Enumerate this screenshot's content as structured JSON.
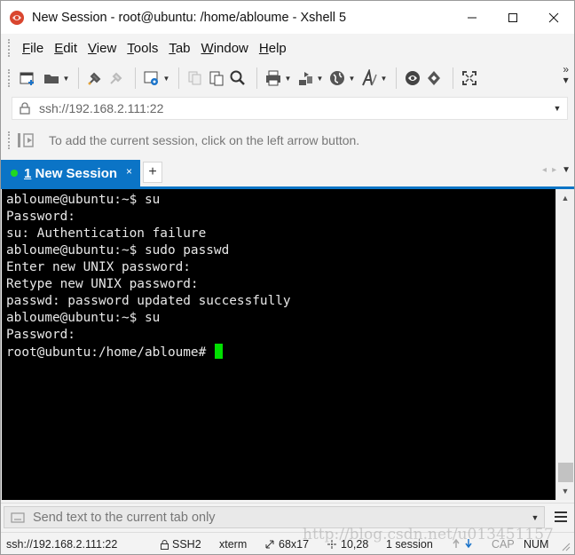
{
  "window": {
    "title": "New Session - root@ubuntu: /home/abloume - Xshell 5",
    "controls": {
      "minimize": "—",
      "maximize": "☐",
      "close": "✕"
    }
  },
  "menu": {
    "items": [
      {
        "accel": "F",
        "rest": "ile"
      },
      {
        "accel": "E",
        "rest": "dit"
      },
      {
        "accel": "V",
        "rest": "iew"
      },
      {
        "accel": "T",
        "rest": "ools"
      },
      {
        "accel": "T",
        "rest": "ab"
      },
      {
        "accel": "W",
        "rest": "indow"
      },
      {
        "accel": "H",
        "rest": "elp"
      }
    ]
  },
  "toolbar": {
    "icons": [
      "new-session-icon",
      "open-folder-icon",
      "connect-icon",
      "disconnect-icon",
      "properties-icon",
      "copy-icon",
      "paste-icon",
      "find-icon",
      "print-icon",
      "transfer-icon",
      "globe-icon",
      "font-icon",
      "xftp-icon",
      "xmanager-icon",
      "fullscreen-icon"
    ],
    "more": "»"
  },
  "address": {
    "value": "ssh://192.168.2.111:22"
  },
  "hint": {
    "text": "To add the current session, click on the left arrow button."
  },
  "tabs": {
    "active": {
      "number": "1",
      "label": "New Session",
      "close": "×"
    },
    "add": "+"
  },
  "terminal": {
    "lines": [
      "abloume@ubuntu:~$ su",
      "Password:",
      "su: Authentication failure",
      "abloume@ubuntu:~$ sudo passwd",
      "Enter new UNIX password:",
      "Retype new UNIX password:",
      "passwd: password updated successfully",
      "abloume@ubuntu:~$ su",
      "Password:"
    ],
    "prompt": "root@ubuntu:/home/abloume# ",
    "cursor_color": "#00e000"
  },
  "sendbar": {
    "placeholder": "Send text to the current tab only"
  },
  "status": {
    "connection": "ssh://192.168.2.111:22",
    "protocol": "SSH2",
    "terminal_type": "xterm",
    "size": "68x17",
    "cursor_pos": "10,28",
    "sessions": "1 session",
    "cap": "CAP",
    "num": "NUM"
  },
  "watermark": "http://blog.csdn.net/u013451157",
  "colors": {
    "accent": "#0b74c6",
    "terminal_bg": "#000000",
    "terminal_fg": "#e8e8e8"
  }
}
